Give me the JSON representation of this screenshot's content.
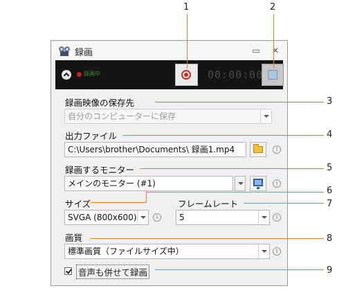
{
  "callouts": [
    "1",
    "2",
    "3",
    "4",
    "5",
    "6",
    "7",
    "8",
    "9"
  ],
  "window": {
    "title": "録画",
    "minimize_glyph": "▭",
    "close_glyph": "✕"
  },
  "toolbar": {
    "status": "録画中",
    "timer": "00:00:00"
  },
  "save_dest": {
    "label": "録画映像の保存先",
    "value": "自分のコンピューターに保存"
  },
  "output_file": {
    "label": "出力ファイル",
    "value": "C:\\Users\\brother\\Documents\\ 録画1.mp4"
  },
  "monitor": {
    "label": "録画するモニター",
    "value": "メインのモニター (#1)"
  },
  "size": {
    "label": "サイズ",
    "value": "SVGA (800x600)"
  },
  "framerate": {
    "label": "フレームレート",
    "value": "5"
  },
  "quality": {
    "label": "画質",
    "value": "標準画質（ファイルサイズ中）"
  },
  "audio": {
    "label": "音声も併せて録画",
    "checked": true
  },
  "info_glyph": "i",
  "accent_colors": {
    "leader": "#e0821e",
    "record": "#d02a20",
    "status_text": "#3d8a2e"
  }
}
